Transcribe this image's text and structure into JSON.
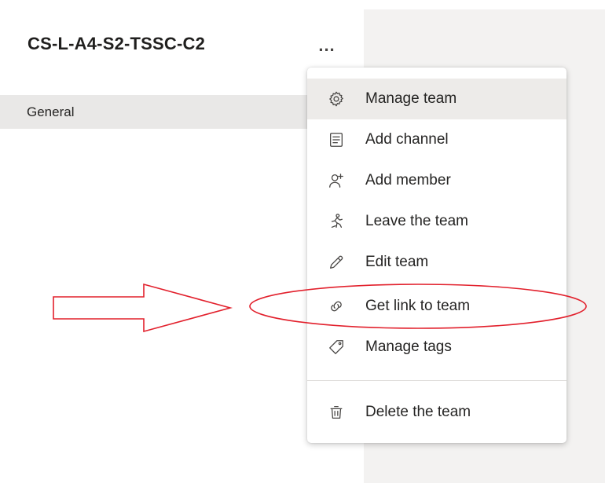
{
  "team": {
    "name": "CS-L-A4-S2-TSSC-C2",
    "more_label": "..."
  },
  "channels": [
    {
      "label": "General"
    }
  ],
  "menu": {
    "items": [
      {
        "label": "Manage team",
        "icon": "gear-icon"
      },
      {
        "label": "Add channel",
        "icon": "channel-list-icon"
      },
      {
        "label": "Add member",
        "icon": "add-person-icon"
      },
      {
        "label": "Leave the team",
        "icon": "running-person-icon"
      },
      {
        "label": "Edit team",
        "icon": "pencil-icon"
      },
      {
        "label": "Get link to team",
        "icon": "link-icon"
      },
      {
        "label": "Manage tags",
        "icon": "tag-icon"
      },
      {
        "label": "Delete the team",
        "icon": "trash-icon"
      }
    ]
  },
  "colors": {
    "annotation": "#e2202c",
    "hover": "#edebe9",
    "pane": "#f3f2f1"
  }
}
